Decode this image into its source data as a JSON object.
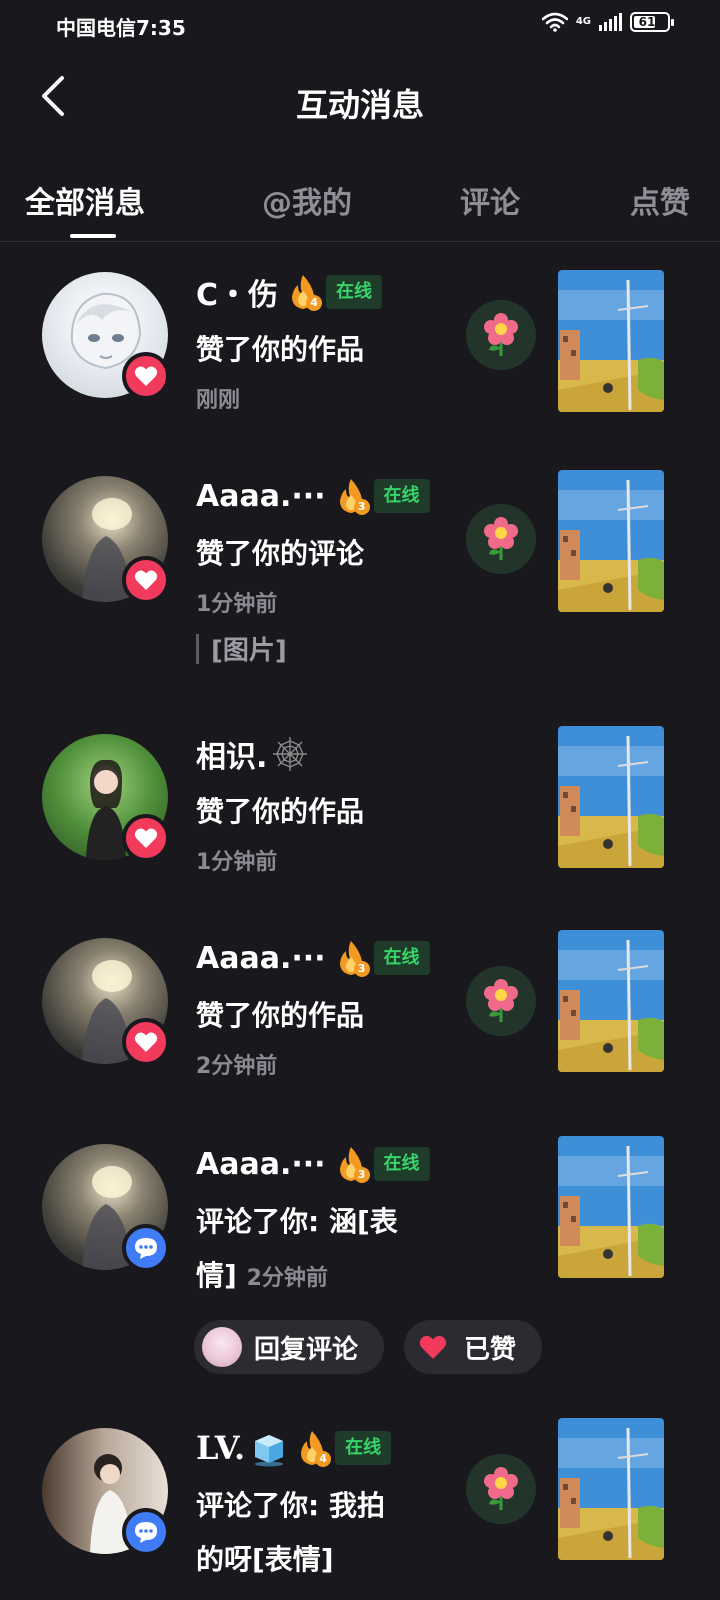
{
  "status_bar": {
    "left_text": "中国电信7:35",
    "network": "4G",
    "battery": "61"
  },
  "header": {
    "title": "互动消息"
  },
  "tabs": [
    {
      "label": "全部消息",
      "active": true
    },
    {
      "label": "@我的",
      "active": false
    },
    {
      "label": "评论",
      "active": false
    },
    {
      "label": "点赞",
      "active": false
    }
  ],
  "notifications": [
    {
      "name": "C・伤",
      "fire_level": "4",
      "online": "在线",
      "action": "赞了你的作品",
      "time": "刚刚",
      "badge": "like"
    },
    {
      "name": "Aaaa.···",
      "fire_level": "3",
      "online": "在线",
      "action": "赞了你的评论",
      "time": "1分钟前",
      "quote": "[图片]",
      "badge": "like"
    },
    {
      "name": "相识.",
      "action": "赞了你的作品",
      "time": "1分钟前",
      "badge": "like"
    },
    {
      "name": "Aaaa.···",
      "fire_level": "3",
      "online": "在线",
      "action": "赞了你的作品",
      "time": "2分钟前",
      "badge": "like"
    },
    {
      "name": "Aaaa.···",
      "fire_level": "3",
      "online": "在线",
      "action_line1": "评论了你: 涵[表",
      "action_line2": "情]",
      "time": "2分钟前",
      "reply_label": "回复评论",
      "liked_label": "已赞",
      "badge": "comment"
    },
    {
      "name": "LV.",
      "fire_level": "4",
      "online": "在线",
      "action_line1": "评论了你: 我拍",
      "action_line2": "的呀[表情]",
      "badge": "comment"
    }
  ],
  "colors": {
    "background": "#18181d",
    "like_badge": "#f23a5d",
    "comment_badge": "#3f7cf6",
    "online_text": "#37d46a",
    "online_bg": "#1f3b2a",
    "fire": "#f29a22"
  },
  "icons": [
    "back-arrow-icon",
    "wifi-icon",
    "signal-icon",
    "battery-icon",
    "heart-icon",
    "comment-icon",
    "fire-icon",
    "flower-icon",
    "cobweb-icon",
    "ice-cube-icon"
  ]
}
